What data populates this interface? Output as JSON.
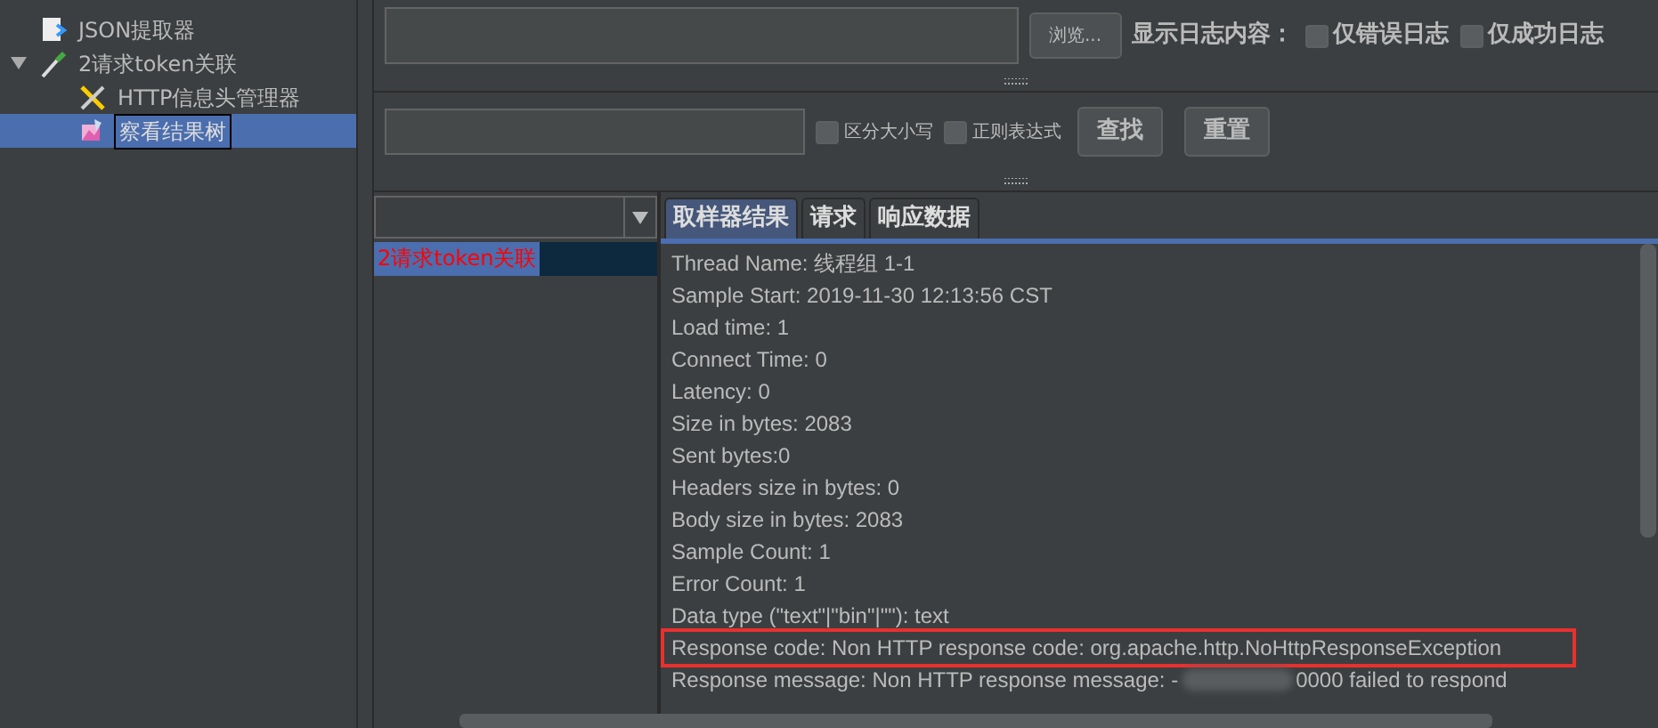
{
  "tree": {
    "items": [
      {
        "label": "JSON提取器",
        "kind": "extractor",
        "selected": false
      },
      {
        "label": "2请求token关联",
        "kind": "sampler",
        "selected": false,
        "expanded": true,
        "children": [
          {
            "label": "HTTP信息头管理器",
            "kind": "config",
            "selected": false
          },
          {
            "label": "察看结果树",
            "kind": "listener",
            "selected": true
          }
        ]
      }
    ]
  },
  "log_panel": {
    "browse_button": "浏览...",
    "show_log_label": "显示日志内容：",
    "checkboxes": [
      {
        "label": "仅错误日志",
        "checked": false
      },
      {
        "label": "仅成功日志",
        "checked": false
      }
    ]
  },
  "search": {
    "checkboxes": [
      {
        "label": "区分大小写",
        "checked": false
      },
      {
        "label": "正则表达式",
        "checked": false
      }
    ],
    "buttons": [
      "查找",
      "重置"
    ]
  },
  "results": [
    {
      "label": "2请求token关联",
      "selected": true,
      "error": true
    }
  ],
  "tabs": [
    {
      "label": "取样器结果",
      "selected": true
    },
    {
      "label": "请求",
      "selected": false
    },
    {
      "label": "响应数据",
      "selected": false
    }
  ],
  "sampler_lines": [
    {
      "text": "Thread Name: 线程组 1-1",
      "highlighted": false
    },
    {
      "text": "Sample Start: 2019-11-30 12:13:56 CST",
      "highlighted": false
    },
    {
      "text": "Load time: 1",
      "highlighted": false
    },
    {
      "text": "Connect Time: 0",
      "highlighted": false
    },
    {
      "text": "Latency: 0",
      "highlighted": false
    },
    {
      "text": "Size in bytes: 2083",
      "highlighted": false
    },
    {
      "text": "Sent bytes:0",
      "highlighted": false
    },
    {
      "text": "Headers size in bytes: 0",
      "highlighted": false
    },
    {
      "text": "Body size in bytes: 2083",
      "highlighted": false
    },
    {
      "text": "Sample Count: 1",
      "highlighted": false
    },
    {
      "text": "Error Count: 1",
      "highlighted": false
    },
    {
      "text": "Data type (\"text\"|\"bin\"|\"\"): text",
      "highlighted": false
    },
    {
      "text": "Response code: Non HTTP response code: org.apache.http.NoHttpResponseException",
      "highlighted": true
    }
  ],
  "redacted_line": {
    "before": "Response message: Non HTTP response message: -",
    "after": "0000 failed to respond"
  }
}
